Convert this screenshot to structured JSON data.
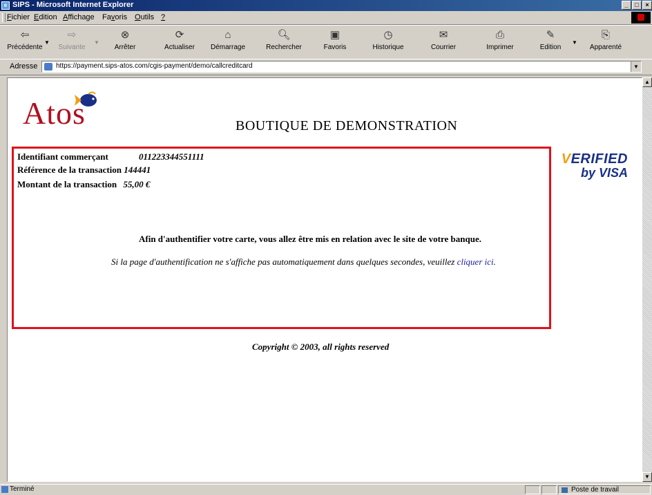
{
  "window": {
    "title": "SIPS - Microsoft Internet Explorer"
  },
  "menu": [
    {
      "label": "Fichier",
      "accel": "F",
      "rest": "ichier"
    },
    {
      "label": "Edition",
      "accel": "E",
      "rest": "dition"
    },
    {
      "label": "Affichage",
      "accel": "A",
      "rest": "ffichage"
    },
    {
      "label": "Favoris",
      "pre": "Fa",
      "accel": "v",
      "rest": "oris"
    },
    {
      "label": "Outils",
      "accel": "O",
      "rest": "utils"
    },
    {
      "label": "?",
      "accel": "?",
      "rest": ""
    }
  ],
  "toolbar": {
    "back": "Précédente",
    "forward": "Suivante",
    "stop": "Arrêter",
    "refresh": "Actualiser",
    "home": "Démarrage",
    "search": "Rechercher",
    "favorites": "Favoris",
    "history": "Historique",
    "mail": "Courrier",
    "print": "Imprimer",
    "edit": "Edition",
    "discuss": "Apparenté"
  },
  "address": {
    "label": "Adresse",
    "url": "https://payment.sips-atos.com/cgis-payment/demo/callcreditcard"
  },
  "page": {
    "logo_text": "Atos",
    "shop_title": "BOUTIQUE DE DEMONSTRATION",
    "merchant_label": "Identifiant commerçant",
    "merchant_value": "011223344551111",
    "reference_label": "Référence de la transaction",
    "reference_value": "144441",
    "amount_label": "Montant de la transaction",
    "amount_value": "55,00 €",
    "vbv_line1": "ERIFIED",
    "vbv_check": "V",
    "vbv_line2": "by VISA",
    "auth_message": "Afin d'authentifier votre carte, vous allez être mis en relation avec le site de votre banque.",
    "auth_sub_prefix": "Si la page d'authentification ne s'affiche pas automatiquement dans quelques secondes, veuillez ",
    "auth_link": "cliquer ici",
    "auth_sub_suffix": ".",
    "copyright": "Copyright © 2003, all rights reserved"
  },
  "status": {
    "text": "Terminé",
    "zone": "Poste de travail"
  }
}
